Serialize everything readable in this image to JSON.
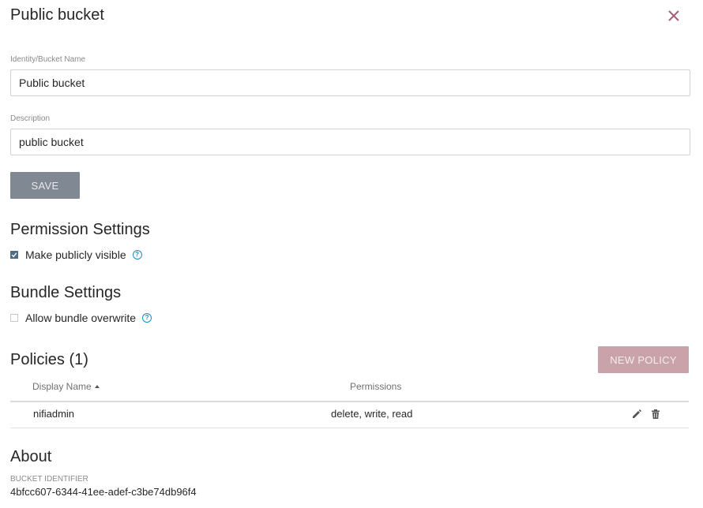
{
  "dialog": {
    "title": "Public bucket"
  },
  "form": {
    "name_label": "Identity/Bucket Name",
    "name_value": "Public bucket",
    "description_label": "Description",
    "description_value": "public bucket",
    "save_label": "SAVE"
  },
  "permission_settings": {
    "heading": "Permission Settings",
    "publicly_visible_label": "Make publicly visible",
    "publicly_visible_checked": true
  },
  "bundle_settings": {
    "heading": "Bundle Settings",
    "allow_overwrite_label": "Allow bundle overwrite",
    "allow_overwrite_checked": false
  },
  "policies": {
    "heading": "Policies (1)",
    "new_policy_label": "NEW POLICY",
    "columns": {
      "display_name": "Display Name",
      "permissions": "Permissions"
    },
    "rows": [
      {
        "display_name": "nifiadmin",
        "permissions": "delete, write, read"
      }
    ]
  },
  "about": {
    "heading": "About",
    "bucket_identifier_label": "BUCKET IDENTIFIER",
    "bucket_identifier": "4bfcc607-6344-41ee-adef-c3be74db96f4"
  },
  "colors": {
    "save_button": "#7f8893",
    "new_policy_button": "#caa3aa",
    "close_icon": "#a5607a",
    "help_icon": "#1491c1",
    "checkbox_checked": "#4f6d86"
  },
  "icons": {
    "close": "close-icon",
    "help": "help-circle-icon",
    "edit": "pencil-icon",
    "delete": "trash-icon",
    "sort": "sort-ascending-icon"
  }
}
